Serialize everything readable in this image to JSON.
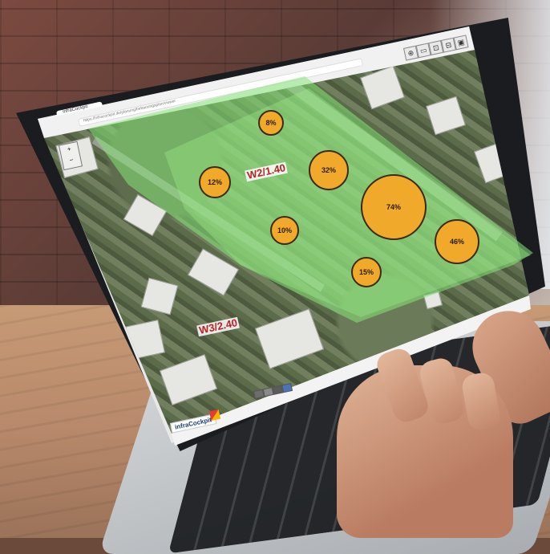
{
  "browser": {
    "tab_title": "infraCockpit",
    "url": "https://infracockpit.de/planung/bebauungsplan/viewer",
    "window_label": "infraCockpit"
  },
  "map": {
    "zones": [
      {
        "label": "W2/1.40"
      },
      {
        "label": "W3/2.40"
      }
    ],
    "bubbles": [
      {
        "label": "8%"
      },
      {
        "label": "12%"
      },
      {
        "label": "32%"
      },
      {
        "label": "74%"
      },
      {
        "label": "10%"
      },
      {
        "label": "46%"
      },
      {
        "label": "15%"
      }
    ],
    "toolbar": [
      "⊕",
      "▭",
      "⊡",
      "⊟",
      "▣"
    ],
    "zoom_control": [
      "+",
      "−"
    ]
  },
  "brand": {
    "name": "infraCockpit"
  },
  "colors": {
    "zone_fill": "#87e678",
    "bubble_fill": "#f0a92a",
    "zone_label": "#b8232a"
  },
  "icons": [
    "zoom-in-icon",
    "zoom-out-icon",
    "layers-icon",
    "fullscreen-icon",
    "print-icon"
  ]
}
